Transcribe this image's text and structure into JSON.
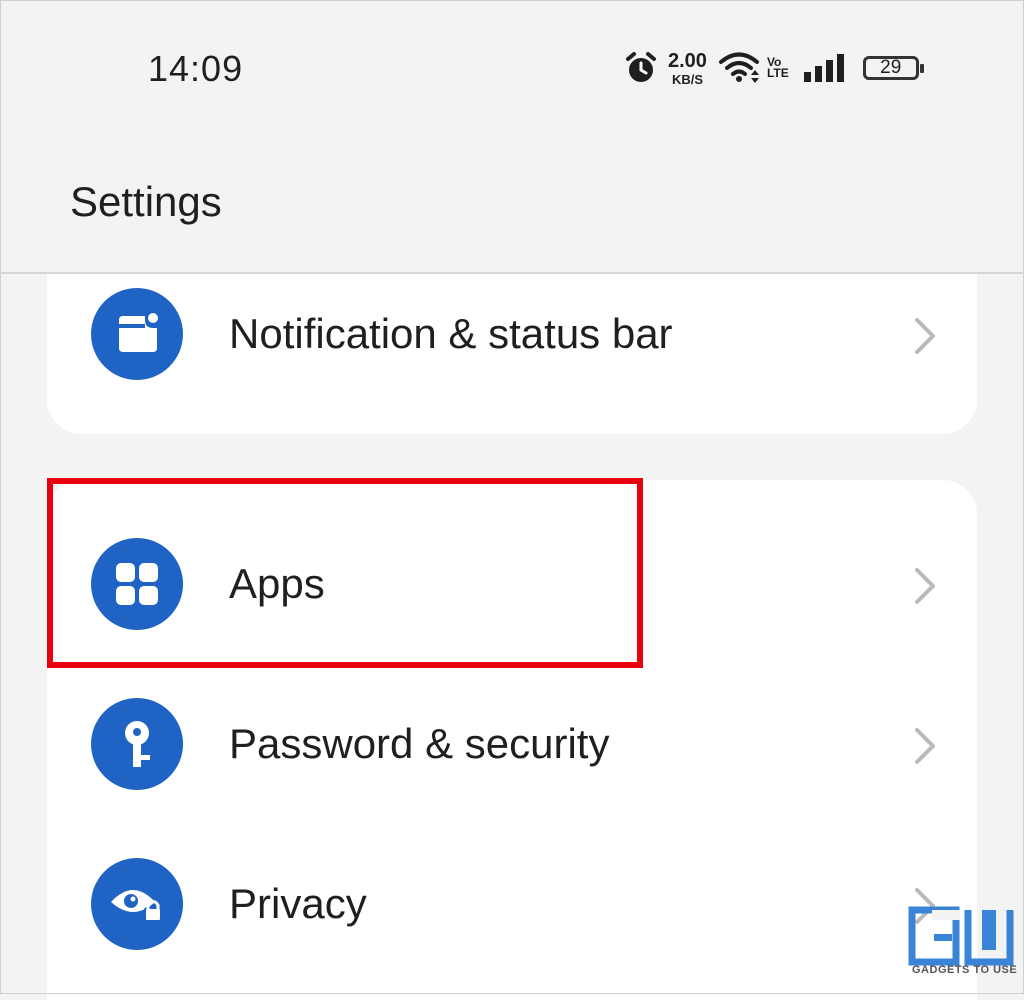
{
  "status_bar": {
    "time": "14:09",
    "net_speed": "2.00",
    "net_speed_unit": "KB/S",
    "volte_top": "Vo",
    "volte_bottom": "LTE",
    "battery": "29",
    "icons": [
      "alarm-icon",
      "wifi-icon",
      "volte-icon",
      "signal-icon",
      "battery-icon"
    ]
  },
  "header": {
    "title": "Settings"
  },
  "items": [
    {
      "label": "Notification & status bar",
      "icon": "notification-icon"
    },
    {
      "label": "Apps",
      "icon": "apps-grid-icon",
      "highlighted": true
    },
    {
      "label": "Password & security",
      "icon": "key-icon"
    },
    {
      "label": "Privacy",
      "icon": "privacy-eye-lock-icon"
    }
  ],
  "watermark": {
    "logo_text": "GU",
    "tagline": "GADGETS TO USE"
  },
  "colors": {
    "background": "#f3f3f3",
    "card": "#ffffff",
    "icon_accent": "#1f64c5",
    "highlight": "#e8000f",
    "text": "#1f1f1f",
    "chevron": "#b9b9b9"
  }
}
